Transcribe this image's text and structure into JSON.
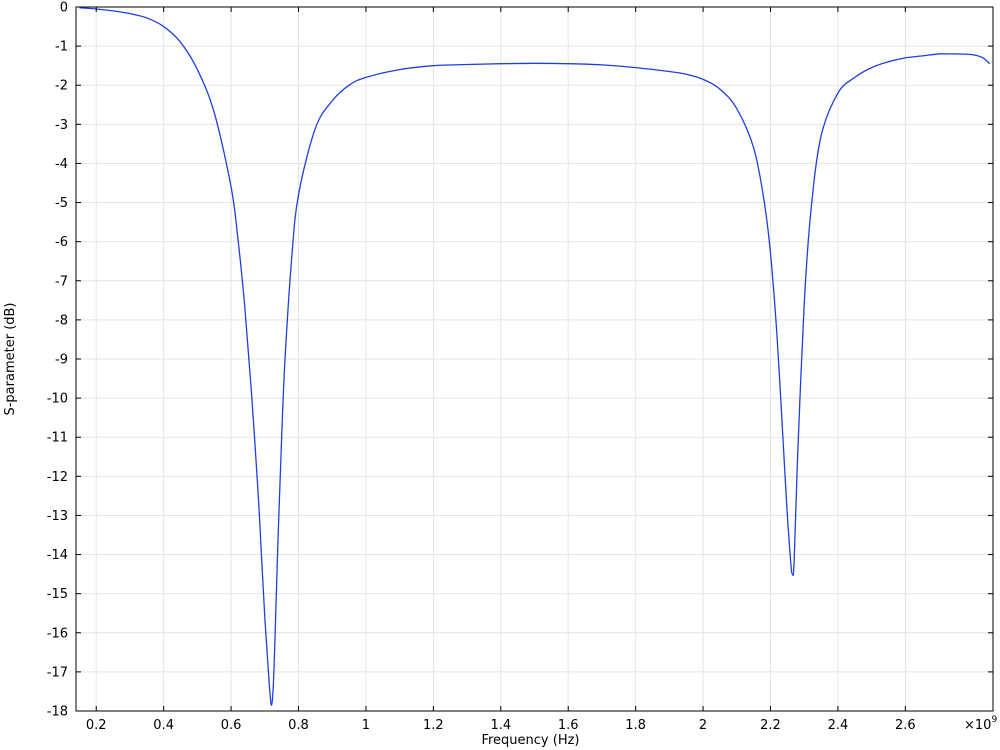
{
  "chart_data": {
    "type": "line",
    "xlabel": "Frequency (Hz)",
    "ylabel": "S-parameter (dB)",
    "x_multiplier_label": "×10",
    "x_multiplier_exponent": "9",
    "xlim": [
      0.14,
      2.86
    ],
    "ylim": [
      -18,
      0
    ],
    "x_ticks": [
      0.2,
      0.4,
      0.6,
      0.8,
      1,
      1.2,
      1.4,
      1.6,
      1.8,
      2,
      2.2,
      2.4,
      2.6
    ],
    "x_tick_labels": [
      "0.2",
      "0.4",
      "0.6",
      "0.8",
      "1",
      "1.2",
      "1.4",
      "1.6",
      "1.8",
      "2",
      "2.2",
      "2.4",
      "2.6"
    ],
    "y_ticks": [
      0,
      -1,
      -2,
      -3,
      -4,
      -5,
      -6,
      -7,
      -8,
      -9,
      -10,
      -11,
      -12,
      -13,
      -14,
      -15,
      -16,
      -17,
      -18
    ],
    "y_tick_labels": [
      "0",
      "-1",
      "-2",
      "-3",
      "-4",
      "-5",
      "-6",
      "-7",
      "-8",
      "-9",
      "-10",
      "-11",
      "-12",
      "-13",
      "-14",
      "-15",
      "-16",
      "-17",
      "-18"
    ],
    "grid": true,
    "line_color": "#1f3fe0",
    "series": [
      {
        "x": [
          0.15,
          0.2,
          0.25,
          0.3,
          0.35,
          0.4,
          0.45,
          0.5,
          0.55,
          0.6,
          0.62,
          0.64,
          0.66,
          0.68,
          0.69,
          0.7,
          0.71,
          0.715,
          0.72,
          0.725,
          0.73,
          0.74,
          0.75,
          0.76,
          0.78,
          0.8,
          0.85,
          0.9,
          0.95,
          1.0,
          1.1,
          1.2,
          1.3,
          1.4,
          1.5,
          1.6,
          1.7,
          1.8,
          1.9,
          1.95,
          2.0,
          2.05,
          2.1,
          2.15,
          2.18,
          2.2,
          2.22,
          2.24,
          2.25,
          2.26,
          2.265,
          2.27,
          2.28,
          2.3,
          2.32,
          2.35,
          2.4,
          2.45,
          2.5,
          2.55,
          2.6,
          2.65,
          2.7,
          2.72,
          2.75,
          2.8,
          2.83,
          2.85
        ],
        "y": [
          -0.02,
          -0.05,
          -0.1,
          -0.17,
          -0.28,
          -0.5,
          -0.9,
          -1.6,
          -2.7,
          -4.6,
          -5.9,
          -7.6,
          -9.8,
          -12.4,
          -14.0,
          -15.6,
          -16.9,
          -17.5,
          -17.85,
          -17.4,
          -16.2,
          -13.4,
          -11.0,
          -9.0,
          -6.4,
          -4.8,
          -3.1,
          -2.4,
          -2.0,
          -1.8,
          -1.6,
          -1.5,
          -1.47,
          -1.45,
          -1.44,
          -1.45,
          -1.48,
          -1.55,
          -1.65,
          -1.72,
          -1.85,
          -2.1,
          -2.6,
          -3.6,
          -4.9,
          -6.3,
          -8.5,
          -11.5,
          -13.0,
          -14.2,
          -14.5,
          -14.2,
          -11.6,
          -7.6,
          -5.2,
          -3.3,
          -2.2,
          -1.8,
          -1.55,
          -1.4,
          -1.3,
          -1.25,
          -1.2,
          -1.2,
          -1.2,
          -1.22,
          -1.3,
          -1.45
        ]
      }
    ]
  }
}
